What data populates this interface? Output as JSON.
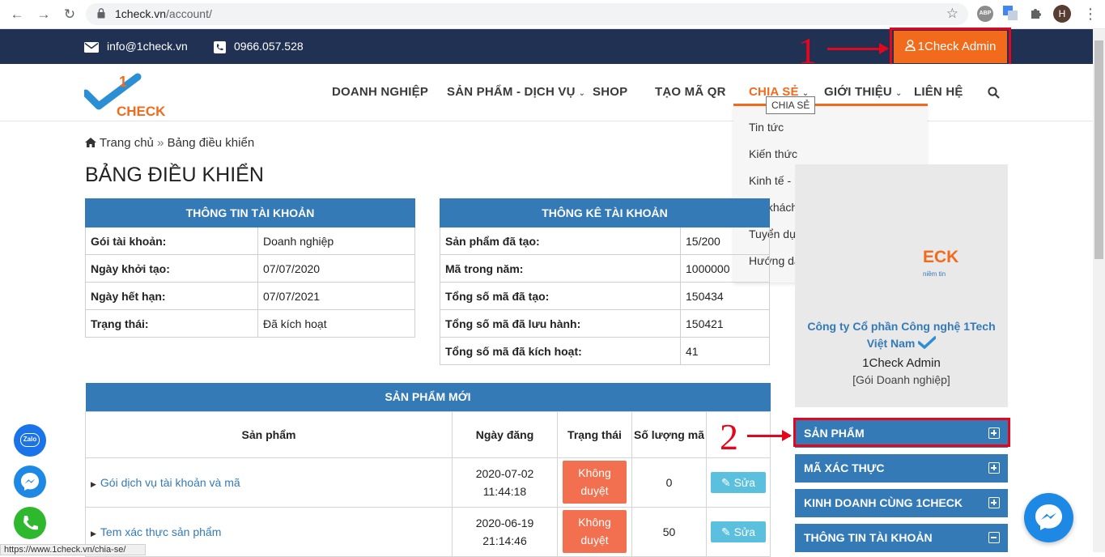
{
  "browser": {
    "url_host": "1check.vn",
    "url_path": "/account/",
    "avatar_letter": "H",
    "ext_abp": "ABP"
  },
  "topbar": {
    "email": "info@1check.vn",
    "phone": "0966.057.528",
    "admin_button": "1Check Admin"
  },
  "annotations": {
    "num1": "1",
    "num2": "2"
  },
  "logo": {
    "text": "CHECK",
    "mark": "1"
  },
  "menu": {
    "items": [
      "DOANH NGHIỆP",
      "SẢN PHẨM - DỊCH VỤ",
      "SHOP",
      "TẠO MÃ QR",
      "CHIA SẺ",
      "GIỚI THIỆU",
      "LIÊN HỆ"
    ],
    "tooltip": "CHIA SẺ",
    "dropdown": [
      "Tin tức",
      "Kiến thức",
      "Kinh tế - Doanh nghiệp",
      "Tin khách hàng",
      "Tuyển dụng",
      "Hướng dẫn"
    ]
  },
  "breadcrumb": {
    "home": "Trang chủ",
    "sep": "»",
    "current": "Bảng điều khiển"
  },
  "page_title": "BẢNG ĐIỀU KHIỂN",
  "account_info": {
    "title": "THÔNG TIN TÀI KHOẢN",
    "rows": [
      {
        "label": "Gói tài khoản:",
        "value": "Doanh nghiệp"
      },
      {
        "label": "Ngày khởi tạo:",
        "value": "07/07/2020"
      },
      {
        "label": "Ngày hết hạn:",
        "value": "07/07/2021"
      },
      {
        "label": "Trạng thái:",
        "value": "Đã kích hoạt"
      }
    ]
  },
  "account_stats": {
    "title": "THÔNG KÊ TÀI KHOẢN",
    "rows": [
      {
        "label": "Sản phẩm đã tạo:",
        "value": "15/200"
      },
      {
        "label": "Mã trong năm:",
        "value": "1000000"
      },
      {
        "label": "Tổng số mã đã tạo:",
        "value": "150434"
      },
      {
        "label": "Tổng số mã đã lưu hành:",
        "value": "150421"
      },
      {
        "label": "Tổng số mã đã kích hoạt:",
        "value": "41"
      }
    ]
  },
  "new_products": {
    "title": "SẢN PHẨM MỚI",
    "headers": [
      "Sản phẩm",
      "Ngày đăng",
      "Trạng thái",
      "Số lượng mã",
      ""
    ],
    "rows": [
      {
        "name": "Gói dịch vụ tài khoản và mã",
        "date": "2020-07-02",
        "time": "11:44:18",
        "status1": "Không",
        "status2": "duyệt",
        "qty": "0",
        "edit": "Sửa"
      },
      {
        "name": "Tem xác thực sản phẩm",
        "date": "2020-06-19",
        "time": "21:14:46",
        "status1": "Không",
        "status2": "duyệt",
        "qty": "50",
        "edit": "Sửa"
      }
    ]
  },
  "sidebar": {
    "logo_text": "ECK",
    "logo_sub": "niềm tin",
    "company_line1": "Công ty Cổ phần Công nghệ 1Tech",
    "company_line2": "Việt Nam",
    "admin_name": "1Check Admin",
    "plan": "[Gói Doanh nghiệp]",
    "buttons": [
      "SẢN PHẨM",
      "MÃ XÁC THỰC",
      "KINH DOANH CÙNG 1CHECK",
      "THÔNG TIN TÀI KHOẢN"
    ]
  },
  "floating": {
    "zalo": "Zalo"
  },
  "status_url": "https://www.1check.vn/chia-se/",
  "colors": {
    "navy": "#213154",
    "orange": "#f26a1b",
    "blue": "#337ab7",
    "red_annotation": "#e3071d"
  }
}
